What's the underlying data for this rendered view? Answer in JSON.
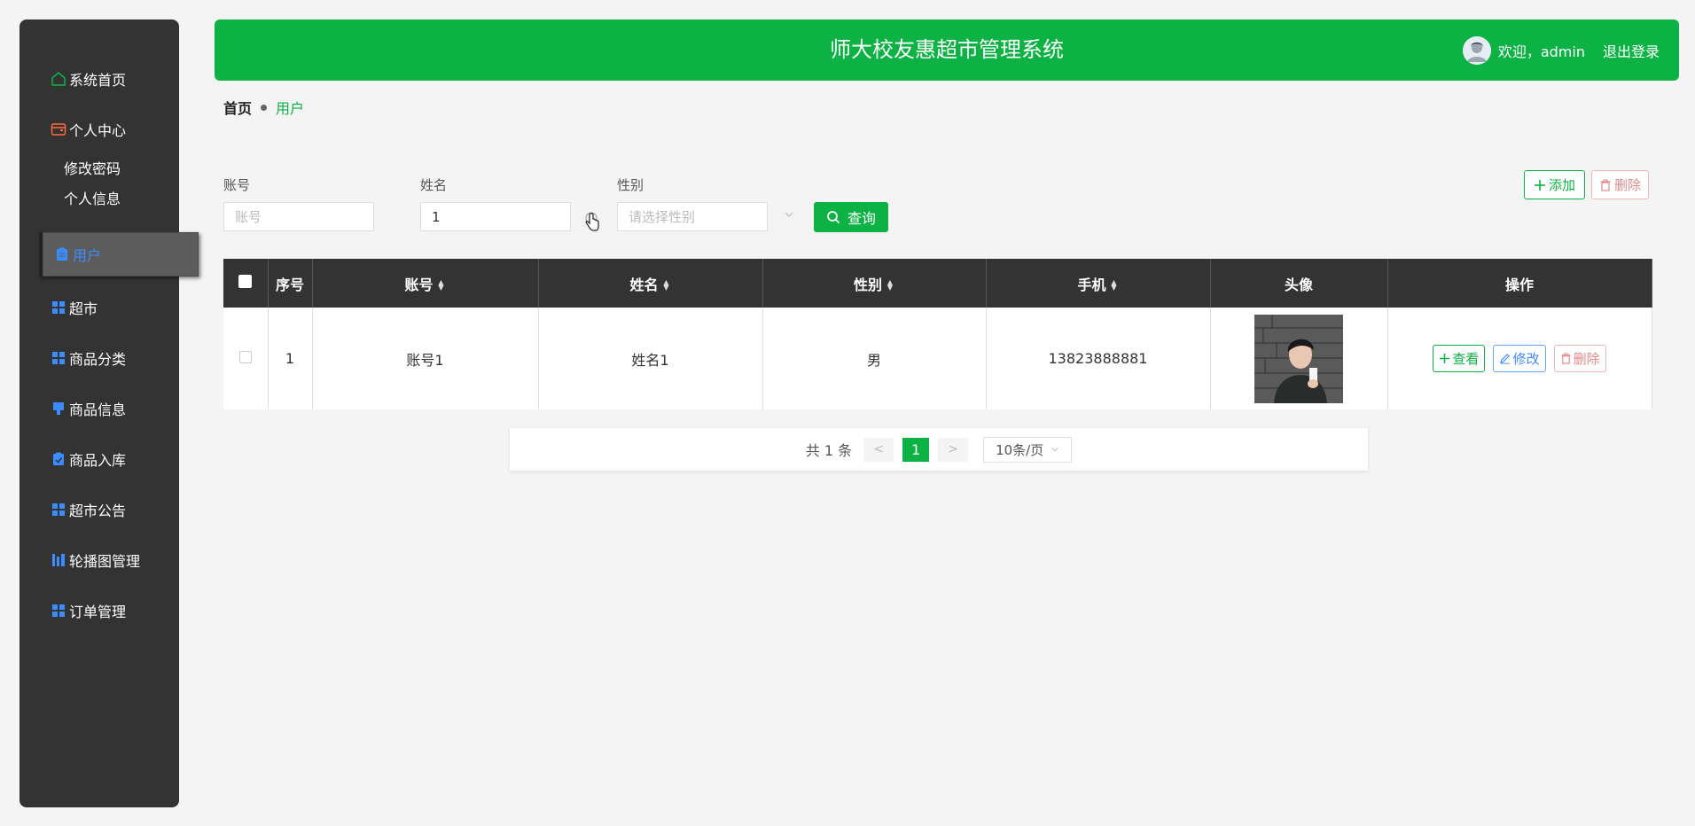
{
  "sidebar": {
    "items": [
      {
        "label": "系统首页",
        "icon": "home-icon"
      },
      {
        "label": "个人中心",
        "icon": "wallet-icon"
      },
      {
        "label": "用户",
        "icon": "clipboard-icon"
      },
      {
        "label": "超市",
        "icon": "grid-icon"
      },
      {
        "label": "商品分类",
        "icon": "grid-icon"
      },
      {
        "label": "商品信息",
        "icon": "stamp-icon"
      },
      {
        "label": "商品入库",
        "icon": "check-clipboard-icon"
      },
      {
        "label": "超市公告",
        "icon": "grid-icon"
      },
      {
        "label": "轮播图管理",
        "icon": "chart-icon"
      },
      {
        "label": "订单管理",
        "icon": "grid-icon"
      }
    ],
    "submenu": [
      "修改密码",
      "个人信息"
    ]
  },
  "header": {
    "title": "师大校友惠超市管理系统",
    "welcome": "欢迎，admin",
    "logout": "退出登录",
    "color": "#0cb244"
  },
  "breadcrumb": {
    "home": "首页",
    "current": "用户"
  },
  "search": {
    "account_label": "账号",
    "account_placeholder": "账号",
    "name_label": "姓名",
    "name_value": "1",
    "gender_label": "性别",
    "gender_placeholder": "请选择性别",
    "query_label": "查询",
    "add_label": "添加",
    "delete_label": "删除"
  },
  "table": {
    "headers": [
      "序号",
      "账号",
      "姓名",
      "性别",
      "手机",
      "头像",
      "操作"
    ],
    "rows": [
      {
        "index": "1",
        "account": "账号1",
        "name": "姓名1",
        "gender": "男",
        "phone": "13823888881"
      }
    ],
    "actions": {
      "view": "查看",
      "edit": "修改",
      "delete": "删除"
    }
  },
  "pagination": {
    "total": "共 1 条",
    "prev": "<",
    "current": "1",
    "next": ">",
    "page_size": "10条/页"
  }
}
